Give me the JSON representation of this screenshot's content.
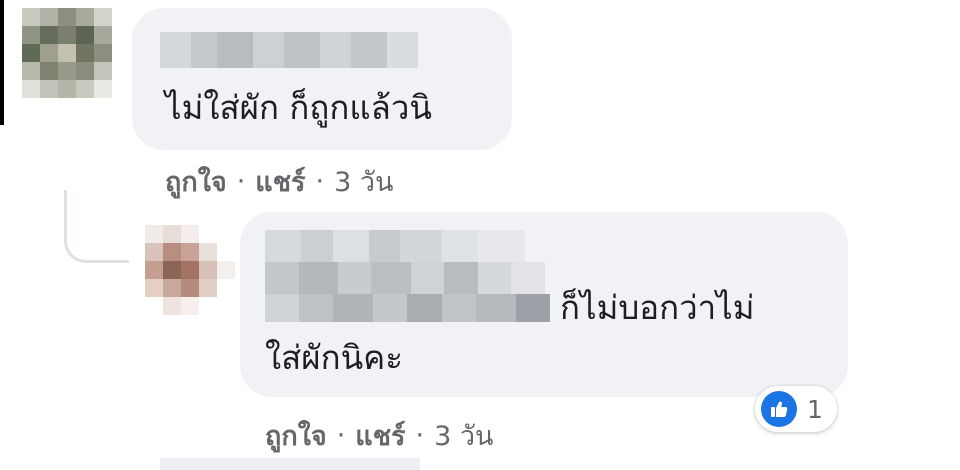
{
  "comments": [
    {
      "text_lines": [
        "ไม่ใส่ผัก ก็ถูกแล้วนิ"
      ],
      "actions": {
        "like": "ถูกใจ",
        "share": "แชร์",
        "time": "3 วัน"
      }
    },
    {
      "text_lines": [
        "ก็ไม่บอกว่าไม่",
        "ใส่ผักนิคะ"
      ],
      "actions": {
        "like": "ถูกใจ",
        "share": "แชร์",
        "time": "3 วัน"
      },
      "reaction": {
        "icon": "like-icon",
        "count": "1"
      }
    }
  ],
  "separator": "·",
  "colors": {
    "bubble": "#f0f2f5",
    "secondary_text": "#65676b",
    "like_blue": "#1b74e4"
  }
}
